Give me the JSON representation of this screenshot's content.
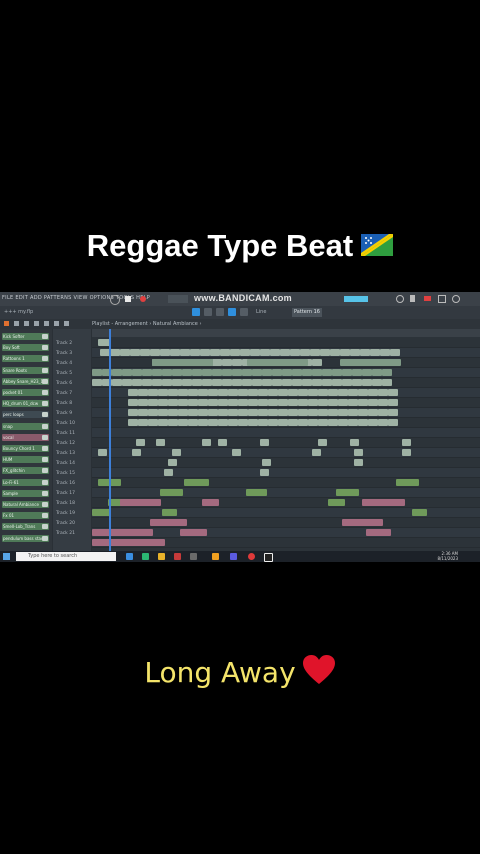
{
  "title": "Reggae Type Beat",
  "caption": "Long Away",
  "flag_icon": "solomon-islands-flag-icon",
  "heart_icon": "red-heart-icon",
  "screenshot": {
    "menu": "FILE  EDIT  ADD  PATTERNS  VIEW  OPTIONS  TOOLS  HELP",
    "watermark": "www.BANDICAM.com",
    "pattern": "Pattern 16",
    "snap": "Line",
    "path": "Playlist - Arrangement › Natural Ambiance ›",
    "channels": [
      "Kick Softer",
      "Boy Soft",
      "Rattoons 1",
      "Snare Roots",
      "Abbey Snare_H23_1",
      "pocket 01",
      "HQ_drum 01_dcw",
      "perc loops",
      "snap",
      "vocal",
      "Bouncy Chord 1",
      "HUM",
      "FX_glitchin",
      "Lo-Fi-61",
      "Sample",
      "Natural Ambiance",
      "Fx 01",
      "Smell-Lob_Trans",
      "pendulum bass stack"
    ],
    "tracks": [
      "Track 2",
      "Track 3",
      "Track 4",
      "Track 5",
      "Track 6",
      "Track 7",
      "Track 8",
      "Track 9",
      "Track 10",
      "Track 11",
      "Track 12",
      "Track 13",
      "Track 14",
      "Track 15",
      "Track 16",
      "Track 17",
      "Track 18",
      "Track 19",
      "Track 20",
      "Track 21"
    ],
    "search_placeholder": "Type here to search",
    "time": "2:36 AM",
    "date": "8/11/2023"
  }
}
